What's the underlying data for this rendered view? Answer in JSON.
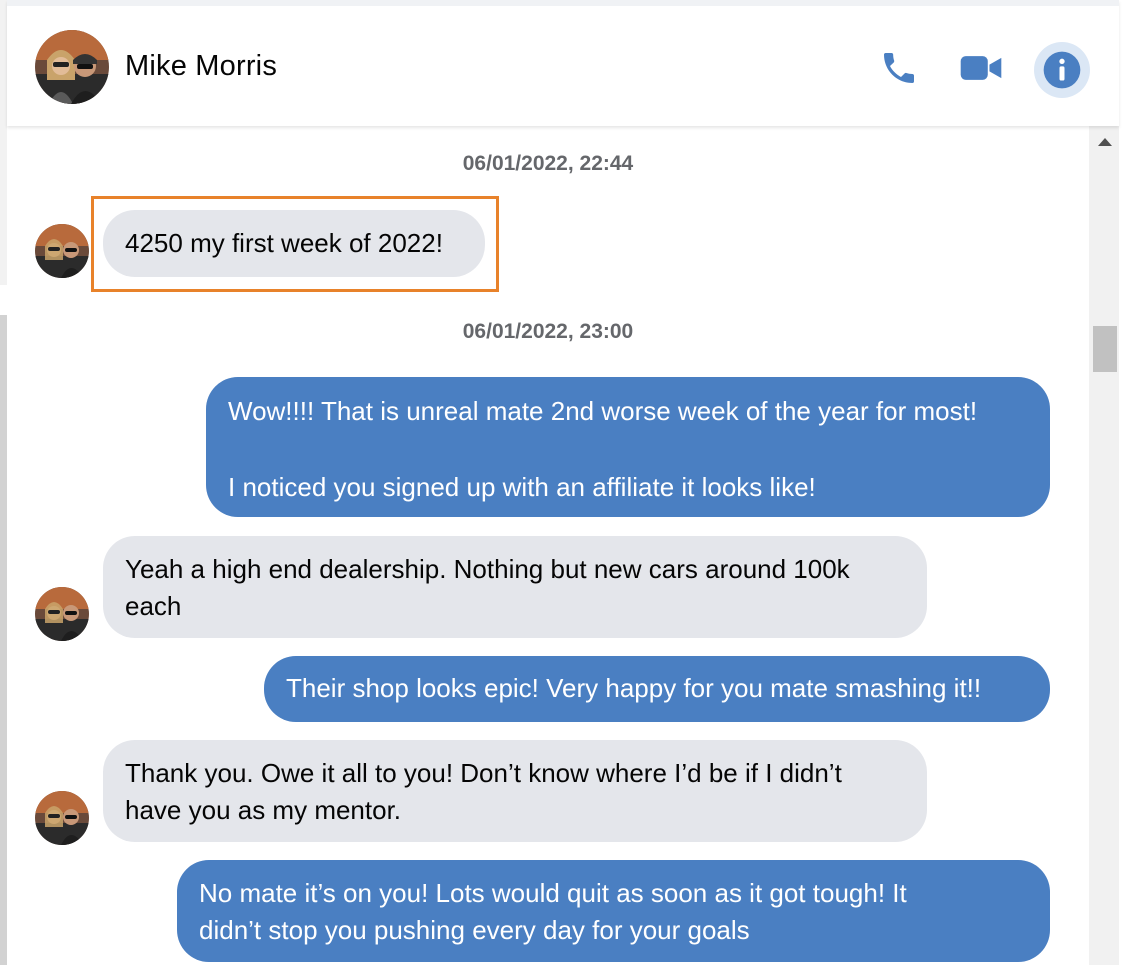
{
  "contact": {
    "name": "Mike Morris",
    "avatar_icon": "contact-photo"
  },
  "header_actions": {
    "call_icon": "phone-icon",
    "video_icon": "video-camera-icon",
    "info_icon": "info-icon",
    "accent_color": "#4a7fc2"
  },
  "conversation": {
    "timestamps": [
      "06/01/2022, 22:44",
      "06/01/2022, 23:00"
    ],
    "messages": [
      {
        "from": "contact",
        "text": "4250 my first week of 2022!"
      },
      {
        "from": "me",
        "text": "Wow!!!! That is unreal mate 2nd worse week of the year for most!\n\nI noticed you signed up with an affiliate it looks like!"
      },
      {
        "from": "contact",
        "text": "Yeah a high end dealership. Nothing but new cars around 100k\neach"
      },
      {
        "from": "me",
        "text": "Their shop looks epic! Very happy for you mate smashing it!!"
      },
      {
        "from": "contact",
        "text": "Thank you. Owe it all to you! Don’t know where I’d be if I didn’t\nhave you as my mentor."
      },
      {
        "from": "me",
        "text": "No mate it’s on you! Lots would quit as soon as it got tough! It\ndidn’t stop you pushing every day for your goals"
      }
    ]
  },
  "colors": {
    "incoming_bubble": "#e4e6eb",
    "outgoing_bubble": "#4a7fc2",
    "highlight_box": "#e8822a"
  }
}
